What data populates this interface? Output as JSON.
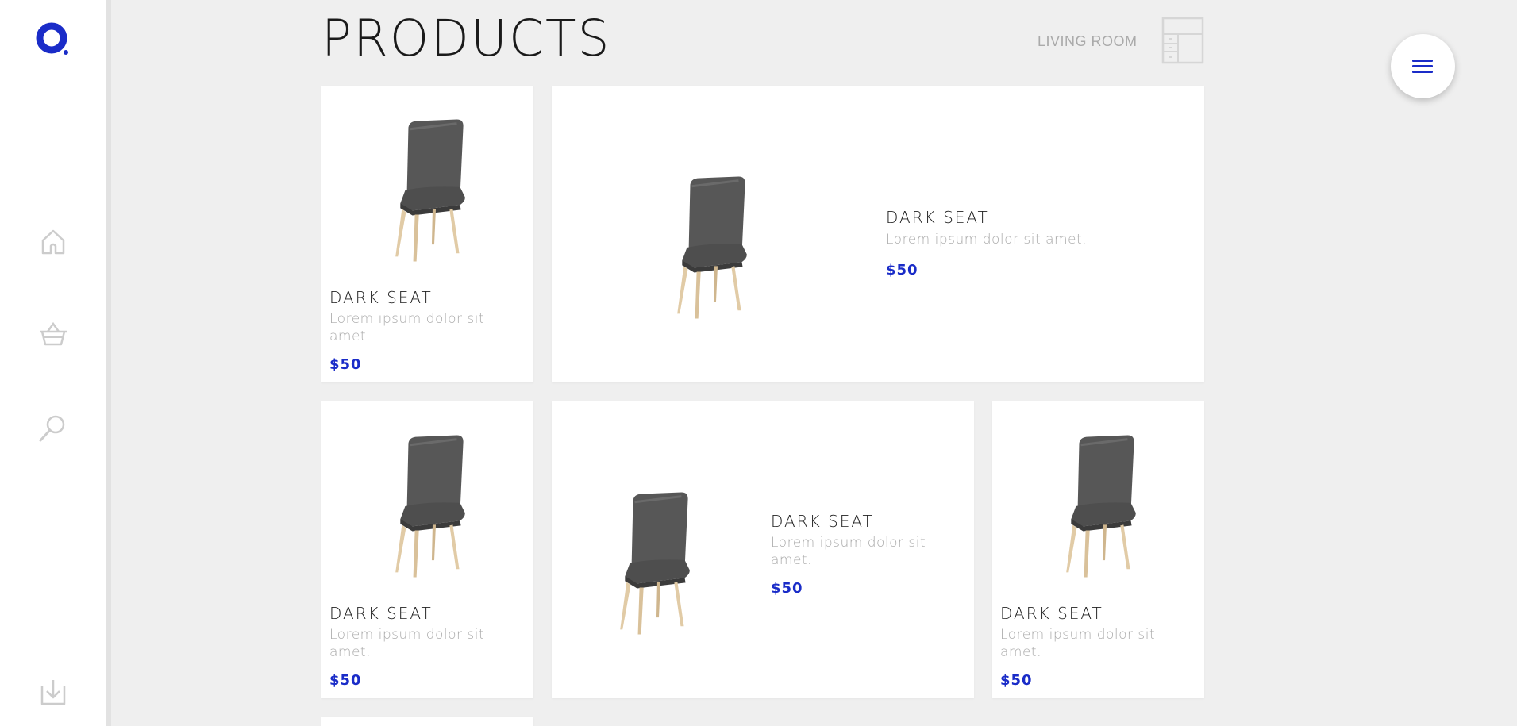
{
  "sidebar": {
    "logo_icon": "logo-ring-icon",
    "nav": [
      {
        "icon": "home-icon"
      },
      {
        "icon": "basket-icon"
      },
      {
        "icon": "search-icon"
      },
      {
        "icon": "download-icon"
      }
    ]
  },
  "header": {
    "title": "PRODUCTS",
    "category": "LIVING ROOM",
    "category_icon": "shelf-furniture-icon"
  },
  "menu_button": {
    "icon": "hamburger-menu-icon"
  },
  "colors": {
    "accent": "#1a2cc8",
    "background": "#efefef",
    "card": "#ffffff",
    "muted_text": "#aaaaaa"
  },
  "products": [
    {
      "name": "DARK SEAT",
      "description": "Lorem ipsum dolor sit amet.",
      "price": "$50"
    },
    {
      "name": "DARK SEAT",
      "description": "Lorem ipsum dolor sit amet.",
      "price": "$50"
    },
    {
      "name": "DARK SEAT",
      "description": "Lorem ipsum dolor sit amet.",
      "price": "$50"
    },
    {
      "name": "DARK SEAT",
      "description": "Lorem ipsum dolor sit amet.",
      "price": "$50"
    },
    {
      "name": "DARK SEAT",
      "description": "Lorem ipsum dolor sit amet.",
      "price": "$50"
    }
  ]
}
